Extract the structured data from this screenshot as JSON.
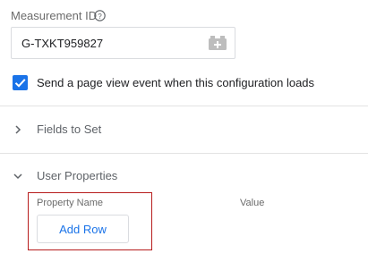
{
  "measurement": {
    "label": "Measurement ID",
    "value": "G-TXKT959827",
    "help_icon": "help-circle-icon",
    "variable_icon": "variable-picker-icon"
  },
  "checkbox": {
    "checked": true,
    "label": "Send a page view event when this configuration loads"
  },
  "sections": [
    {
      "label": "Fields to Set",
      "expanded": false
    },
    {
      "label": "User Properties",
      "expanded": true
    }
  ],
  "user_properties": {
    "col_name": "Property Name",
    "col_value": "Value",
    "add_row_label": "Add Row"
  },
  "colors": {
    "accent": "#1a73e8",
    "highlight_border": "#b71c1c",
    "muted_text": "#6b6b6b"
  }
}
